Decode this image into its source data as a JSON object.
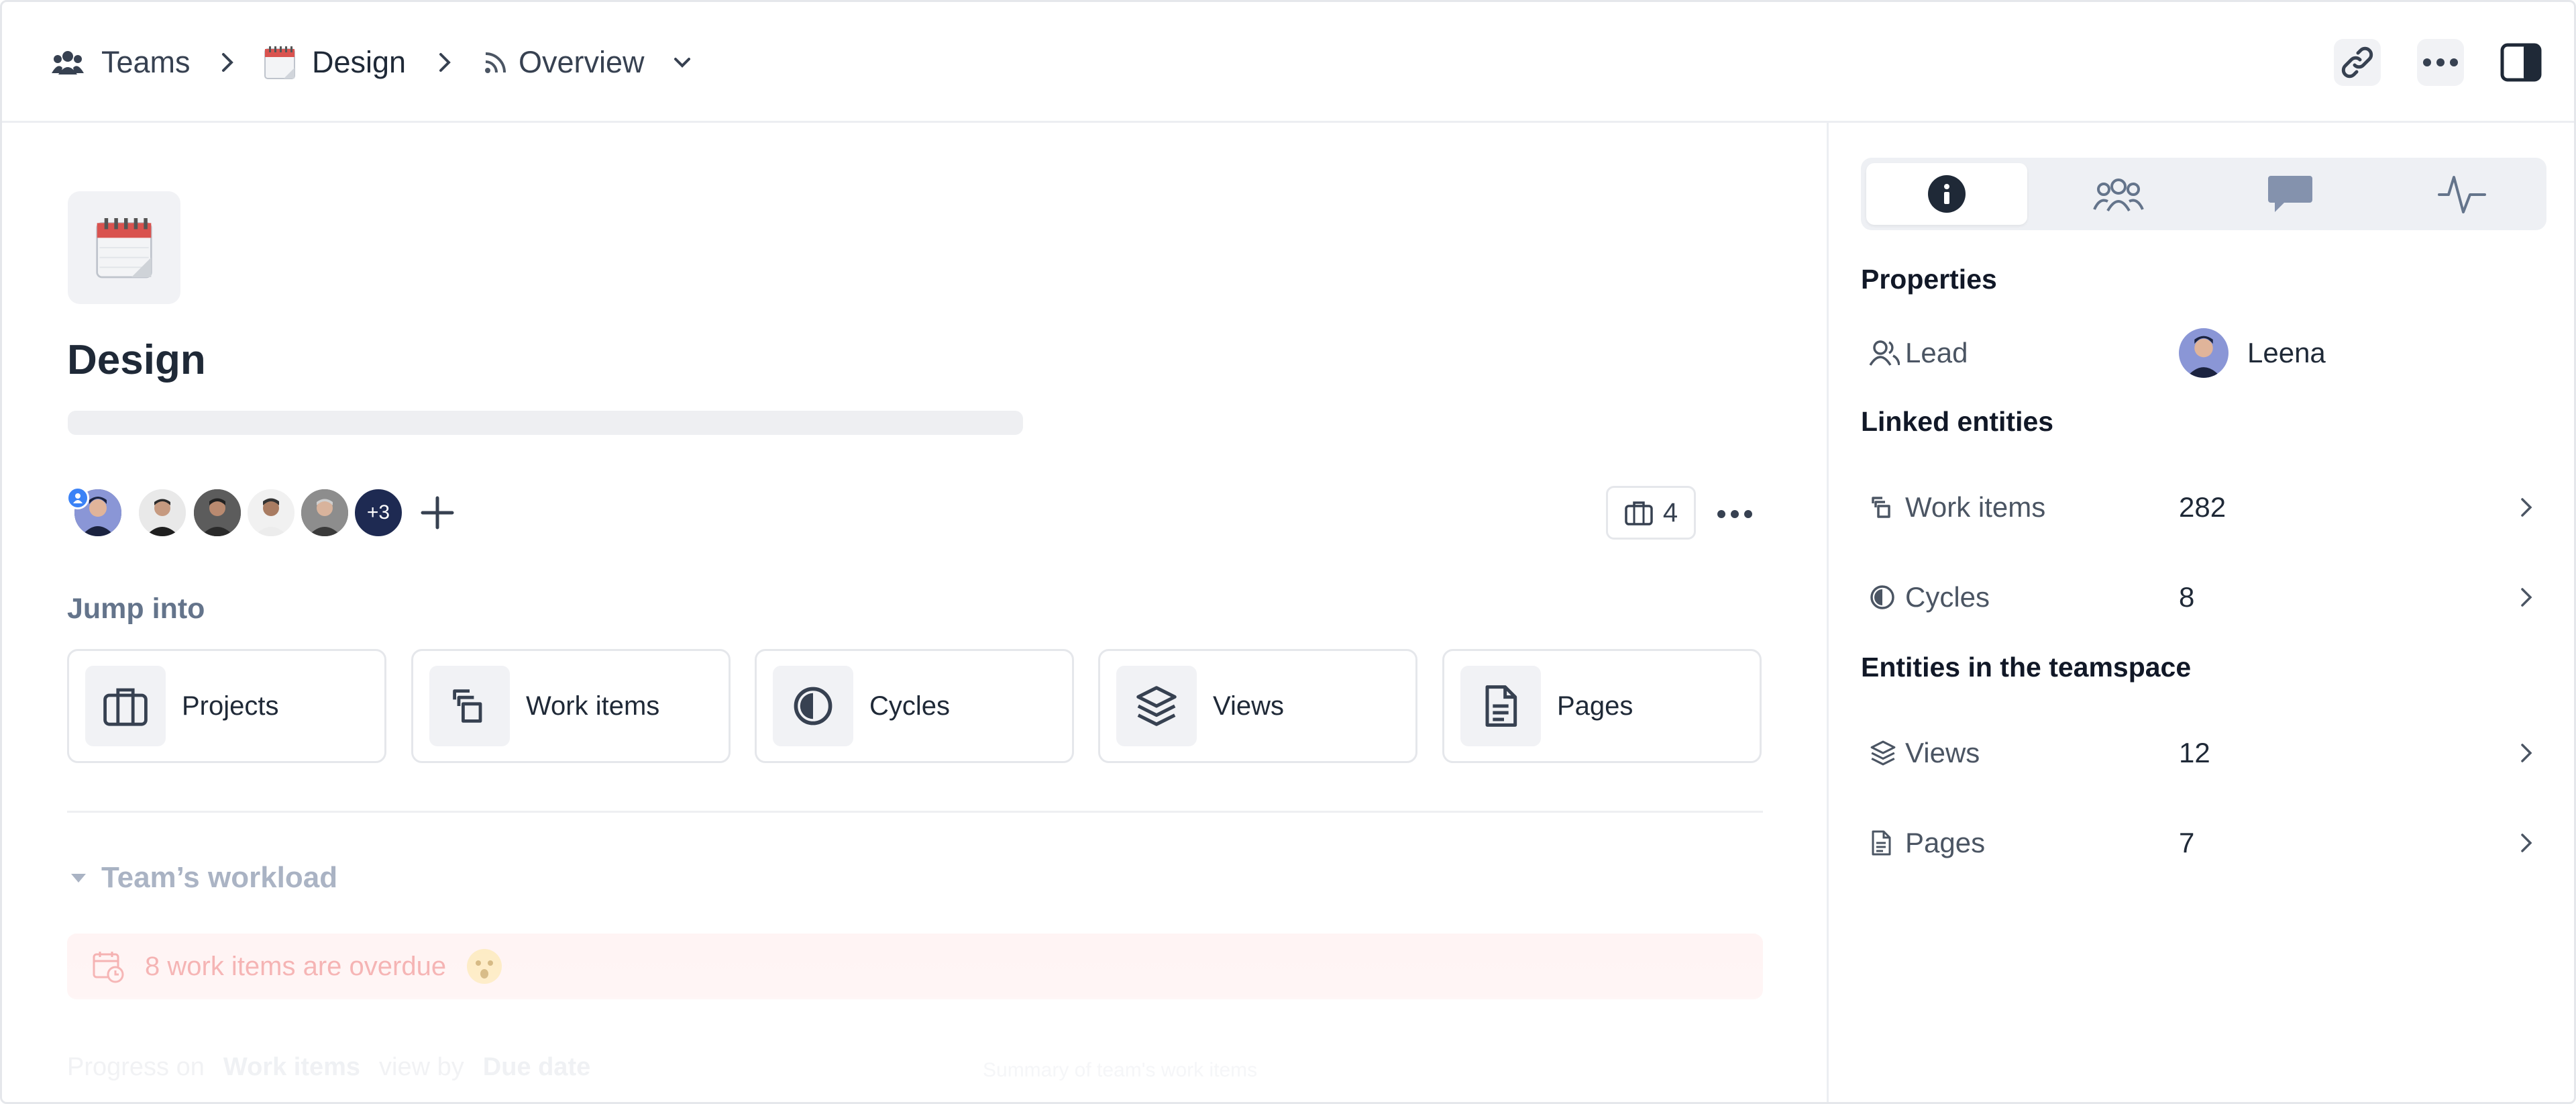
{
  "breadcrumb": {
    "teams_label": "Teams",
    "team_label": "Design",
    "view_label": "Overview"
  },
  "team": {
    "name": "Design",
    "extra_members": "+3",
    "project_count": "4"
  },
  "jump_into": {
    "label": "Jump into",
    "cards": [
      {
        "label": "Projects",
        "icon": "briefcase-icon"
      },
      {
        "label": "Work items",
        "icon": "work-items-icon"
      },
      {
        "label": "Cycles",
        "icon": "cycle-icon"
      },
      {
        "label": "Views",
        "icon": "layers-icon"
      },
      {
        "label": "Pages",
        "icon": "page-icon"
      }
    ]
  },
  "workload": {
    "title": "Team’s workload",
    "overdue_text": "8 work items are overdue",
    "progress_on_label": "Progress on",
    "progress_on_value": "Work items",
    "view_by_label": "view by",
    "view_by_value": "Due date",
    "summary_label": "Summary of team's work items"
  },
  "sidebar": {
    "tabs": [
      {
        "name": "info",
        "icon": "info-icon",
        "active": true
      },
      {
        "name": "members",
        "icon": "members-icon",
        "active": false
      },
      {
        "name": "comments",
        "icon": "comment-icon",
        "active": false
      },
      {
        "name": "activity",
        "icon": "activity-icon",
        "active": false
      }
    ],
    "properties_title": "Properties",
    "lead_label": "Lead",
    "lead_value": "Leena",
    "linked_title": "Linked entities",
    "work_items_label": "Work items",
    "work_items_value": "282",
    "cycles_label": "Cycles",
    "cycles_value": "8",
    "entities_title": "Entities in the teamspace",
    "views_label": "Views",
    "views_value": "12",
    "pages_label": "Pages",
    "pages_value": "7"
  },
  "colors": {
    "accent_dark": "#1e2a52",
    "overdue_bg": "#fff1f1",
    "overdue_text": "#f29a9a",
    "muted_text": "#64748b"
  }
}
